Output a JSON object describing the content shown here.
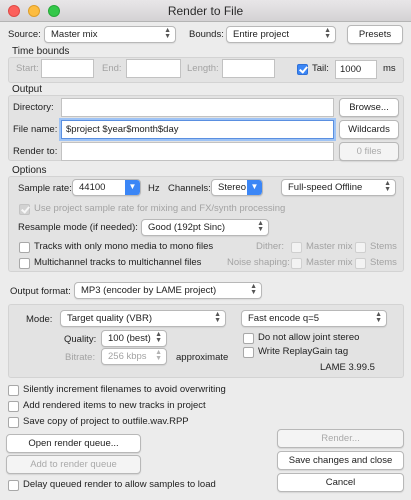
{
  "window": {
    "title": "Render to File"
  },
  "source": {
    "label": "Source:",
    "value": "Master mix"
  },
  "bounds": {
    "label": "Bounds:",
    "value": "Entire project"
  },
  "presets_label": "Presets",
  "time_bounds": {
    "header": "Time bounds",
    "start_label": "Start:",
    "start_value": "",
    "end_label": "End:",
    "end_value": "",
    "length_label": "Length:",
    "length_value": "",
    "tail_label": "Tail:",
    "tail_checked": true,
    "tail_value": "1000",
    "tail_unit": "ms"
  },
  "output": {
    "header": "Output",
    "directory_label": "Directory:",
    "directory_value": "",
    "browse_label": "Browse...",
    "filename_label": "File name:",
    "filename_value": "$project $year$month$day",
    "wildcards_label": "Wildcards",
    "render_to_label": "Render to:",
    "render_to_value": "",
    "files_label": "0 files"
  },
  "options": {
    "header": "Options",
    "sample_rate_label": "Sample rate:",
    "sample_rate_value": "44100",
    "sample_rate_unit": "Hz",
    "channels_label": "Channels:",
    "channels_value": "Stereo",
    "speed_value": "Full-speed Offline",
    "use_project_rate_label": "Use project sample rate for mixing and FX/synth processing",
    "resample_label": "Resample mode (if needed):",
    "resample_value": "Good (192pt Sinc)",
    "mono_media_label": "Tracks with only mono media to mono files",
    "multichannel_label": "Multichannel tracks to multichannel files",
    "dither_label": "Dither:",
    "noise_shaping_label": "Noise shaping:",
    "master_mix_label": "Master mix",
    "stems_label": "Stems"
  },
  "format": {
    "label": "Output format:",
    "value": "MP3 (encoder by LAME project)"
  },
  "mp3": {
    "mode_label": "Mode:",
    "mode_value": "Target quality  (VBR)",
    "encode_value": "Fast encode q=5",
    "quality_label": "Quality:",
    "quality_value": "100 (best)",
    "bitrate_label": "Bitrate:",
    "bitrate_value": "256 kbps",
    "approx_label": "approximate",
    "joint_stereo_label": "Do not allow joint stereo",
    "replaygain_label": "Write ReplayGain tag",
    "lame_version": "LAME 3.99.5"
  },
  "bottom": {
    "silently_increment_label": "Silently increment filenames to avoid overwriting",
    "add_items_label": "Add rendered items to new tracks in project",
    "save_copy_label": "Save copy of project to outfile.wav.RPP",
    "open_queue_label": "Open render queue...",
    "add_queue_label": "Add to render queue",
    "render_label": "Render...",
    "save_close_label": "Save changes and close",
    "cancel_label": "Cancel",
    "delay_label": "Delay queued render to allow samples to load"
  },
  "colors": {
    "accent": "#3b86f6",
    "focus_ring": "#9ec3f5"
  }
}
